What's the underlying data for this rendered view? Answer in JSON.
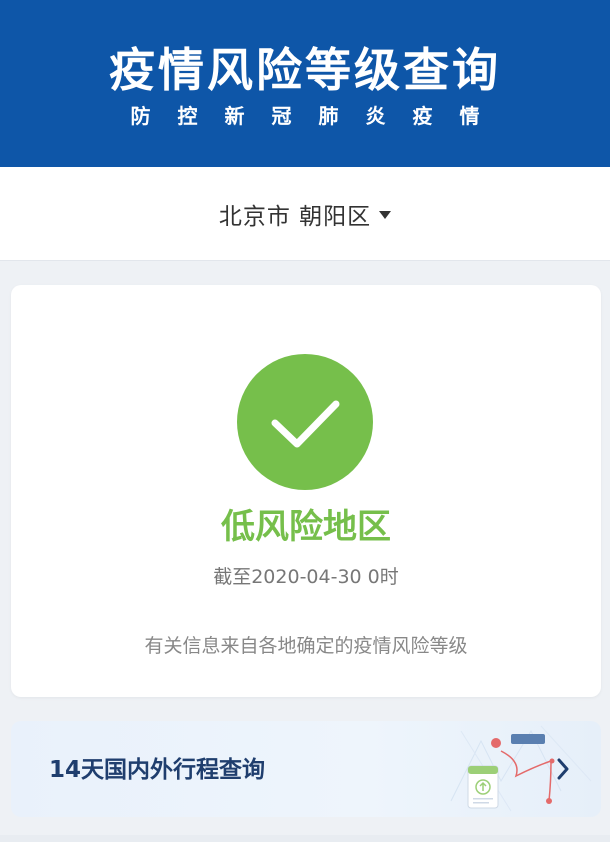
{
  "header": {
    "title": "疫情风险等级查询",
    "subtitle": [
      "防",
      "控",
      "新",
      "冠",
      "肺",
      "炎",
      "疫",
      "情"
    ]
  },
  "region": {
    "selected": "北京市 朝阳区"
  },
  "result": {
    "risk_level": "低风险地区",
    "as_of": "截至2020-04-30 0时",
    "source_note": "有关信息来自各地确定的疫情风险等级",
    "status_color": "#76bf4b"
  },
  "trip_banner": {
    "label": "14天国内外行程查询"
  },
  "colors": {
    "header_bg": "#0e56a8",
    "accent_green": "#76bf4b",
    "banner_text": "#1f3e6e"
  }
}
